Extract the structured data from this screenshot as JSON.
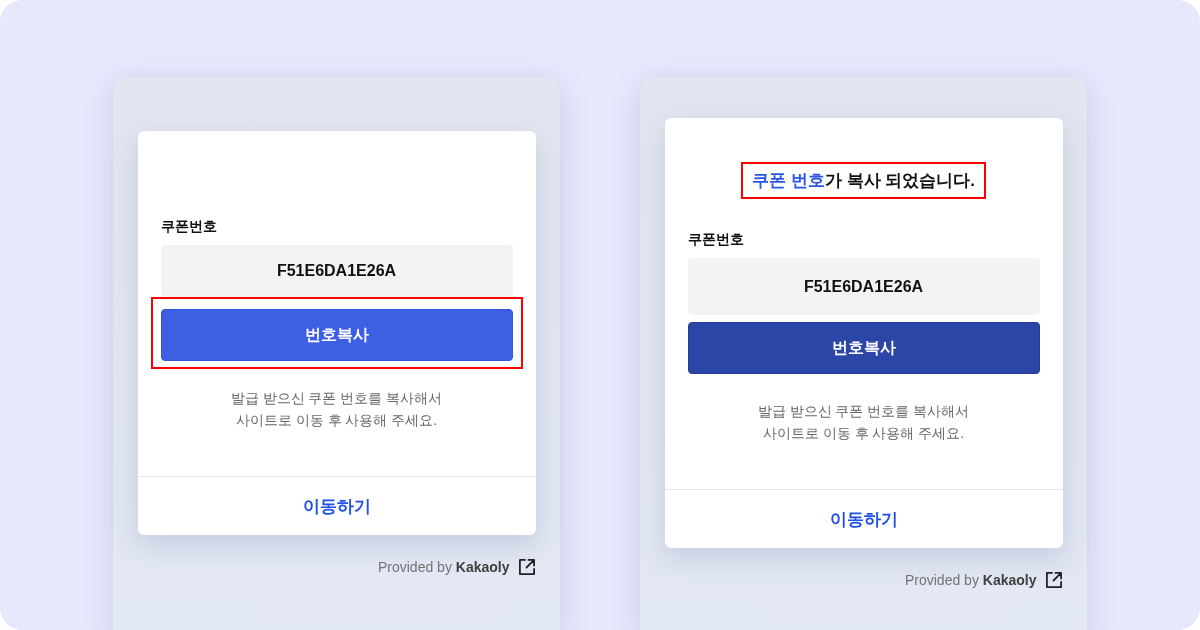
{
  "panels": [
    {
      "label": "쿠폰번호",
      "coupon_code": "F51E6DA1E26A",
      "copy_button": {
        "label": "번호복사",
        "pressed": false,
        "highlighted": true
      },
      "instructions": [
        "발급 받으신 쿠폰 번호를 복사해서",
        "사이트로 이동 후 사용해 주세요."
      ],
      "go_link": "이동하기",
      "provider_note": "Provided by **Kakaoly**"
    },
    {
      "message": {
        "parts": [
          {
            "text": "쿠폰 번호",
            "accent": true
          },
          {
            "text": "가 복사 되었습니다.",
            "accent": false
          }
        ],
        "highlighted": true
      },
      "label": "쿠폰번호",
      "coupon_code": "F51E6DA1E26A",
      "copy_button": {
        "label": "번호복사",
        "pressed": true,
        "highlighted": false
      },
      "instructions": [
        "발급 받으신 쿠폰 번호를 복사해서",
        "사이트로 이동 후 사용해 주세요."
      ],
      "go_link": "이동하기",
      "provider_note": "Provided by **Kakaoly**"
    }
  ]
}
